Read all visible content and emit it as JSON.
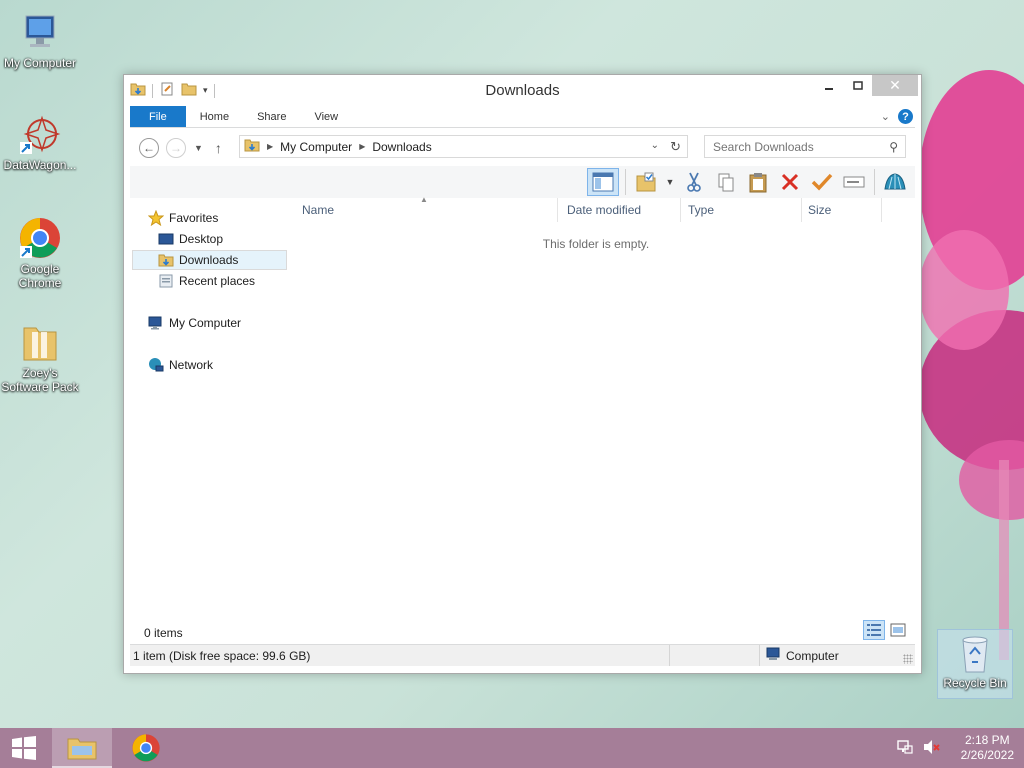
{
  "desktop": {
    "icons": [
      {
        "label": "My Computer"
      },
      {
        "label": "DataWagon..."
      },
      {
        "label": "Google Chrome"
      },
      {
        "label": "Zoey's Software Pack"
      },
      {
        "label": "Recycle Bin"
      }
    ]
  },
  "window": {
    "title": "Downloads",
    "ribbon_tabs": [
      "File",
      "Home",
      "Share",
      "View"
    ],
    "address": {
      "parts": [
        "My Computer",
        "Downloads"
      ]
    },
    "search": {
      "placeholder": "Search Downloads"
    },
    "nav_pane": {
      "favorites": "Favorites",
      "desktop": "Desktop",
      "downloads": "Downloads",
      "recent": "Recent places",
      "my_computer": "My Computer",
      "network": "Network"
    },
    "columns": [
      "Name",
      "Date modified",
      "Type",
      "Size"
    ],
    "empty_message": "This folder is empty.",
    "item_count": "0 items",
    "status": {
      "left": "1 item (Disk free space: 99.6 GB)",
      "right": "Computer"
    }
  },
  "taskbar": {
    "time": "2:18 PM",
    "date": "2/26/2022"
  },
  "colors": {
    "accent": "#1979ca",
    "taskbar": "#a57e98"
  }
}
